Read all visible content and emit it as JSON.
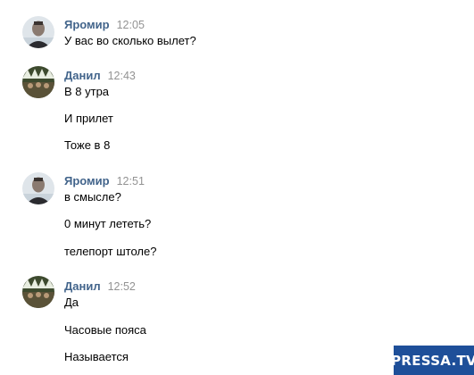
{
  "messages": [
    {
      "author": "Яромир",
      "time": "12:05",
      "avatar": "man-photo-avatar",
      "lines": [
        "У вас во сколько вылет?"
      ]
    },
    {
      "author": "Данил",
      "time": "12:43",
      "avatar": "group-photo-avatar",
      "lines": [
        "В 8 утра",
        "И прилет",
        "Тоже в 8"
      ]
    },
    {
      "author": "Яромир",
      "time": "12:51",
      "avatar": "man-photo-avatar",
      "lines": [
        "в смысле?",
        "0 минут лететь?",
        "телепорт штоле?"
      ]
    },
    {
      "author": "Данил",
      "time": "12:52",
      "avatar": "group-photo-avatar",
      "lines": [
        "Да",
        "Часовые пояса",
        "Называется"
      ]
    }
  ],
  "watermark": "PRESSA.TV",
  "colors": {
    "author": "#42648b",
    "time": "#939393",
    "text": "#000000",
    "watermark_bg": "#1e4f99"
  }
}
